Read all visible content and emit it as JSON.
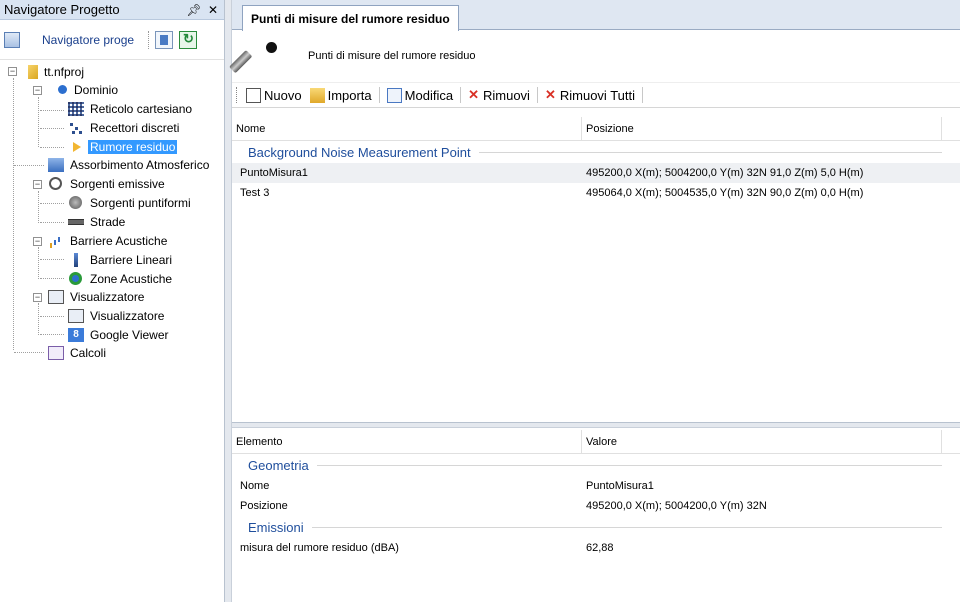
{
  "navigator": {
    "title": "Navigatore Progetto",
    "pin_glyph": "1′",
    "close_glyph": "✕",
    "tab_label": "Navigatore proge",
    "tree": {
      "root": "tt.nfproj",
      "dominio": "Dominio",
      "reticolo": "Reticolo cartesiano",
      "recettori": "Recettori discreti",
      "rumore": "Rumore residuo",
      "assorbimento": "Assorbimento Atmosferico",
      "sorgenti": "Sorgenti emissive",
      "puntiformi": "Sorgenti puntiformi",
      "strade": "Strade",
      "barriere": "Barriere Acustiche",
      "lineari": "Barriere Lineari",
      "zone": "Zone Acustiche",
      "visualizzatore": "Visualizzatore",
      "visualizzatore_child": "Visualizzatore",
      "google": "Google Viewer",
      "calcoli": "Calcoli"
    }
  },
  "document": {
    "tab_title": "Punti di misure del rumore residuo",
    "header_title": "Punti di misure del rumore residuo",
    "toolbar": {
      "nuovo": "Nuovo",
      "importa": "Importa",
      "modifica": "Modifica",
      "rimuovi": "Rimuovi",
      "rimuovi_tutti": "Rimuovi Tutti"
    },
    "list": {
      "col_name": "Nome",
      "col_pos": "Posizione",
      "group": "Background Noise Measurement Point",
      "rows": [
        {
          "name": "PuntoMisura1",
          "pos": "495200,0 X(m); 5004200,0 Y(m) 32N  91,0 Z(m) 5,0 H(m)"
        },
        {
          "name": "Test 3",
          "pos": "495064,0 X(m); 5004535,0 Y(m) 32N  90,0 Z(m) 0,0 H(m)"
        }
      ]
    },
    "props": {
      "col_elem": "Elemento",
      "col_val": "Valore",
      "group_geo": "Geometria",
      "nome_label": "Nome",
      "nome_val": "PuntoMisura1",
      "pos_label": "Posizione",
      "pos_val": "495200,0 X(m); 5004200,0 Y(m) 32N",
      "group_emi": "Emissioni",
      "misura_label": "misura del rumore residuo (dBA)",
      "misura_val": "62,88"
    }
  },
  "colors": {
    "selection": "#3399ff",
    "group_text": "#1f4e9c",
    "panel_header": "#d9e4f2"
  }
}
